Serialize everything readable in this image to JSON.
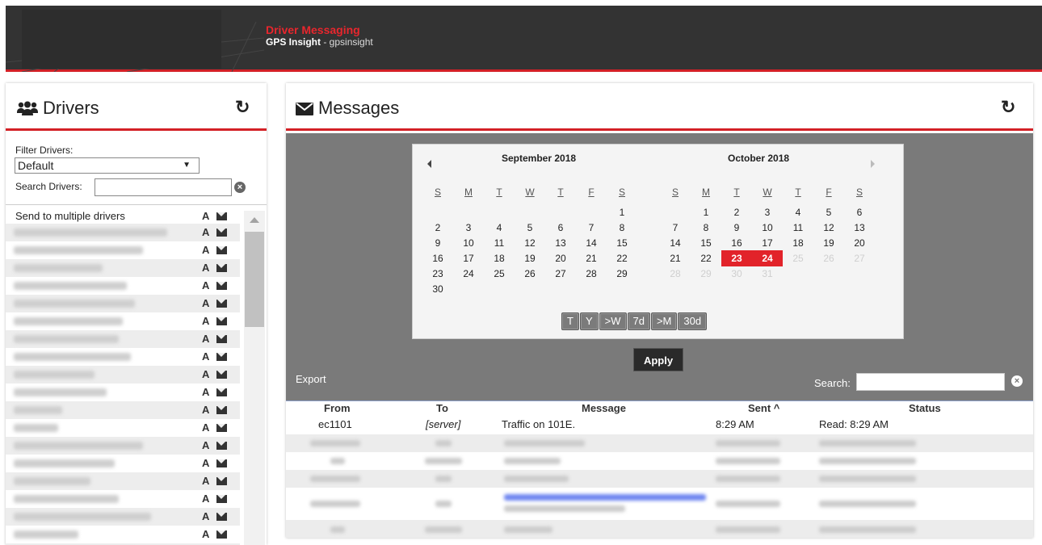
{
  "header": {
    "title": "Driver Messaging",
    "org": "GPS Insight",
    "account": " - gpsinsight"
  },
  "drivers": {
    "title": "Drivers",
    "filter_label": "Filter Drivers:",
    "filter_value": "Default",
    "search_label": "Search Drivers:",
    "multi_label": "Send to multiple drivers",
    "rows": 19
  },
  "messages": {
    "title": "Messages",
    "calendar": {
      "left_month": "September 2018",
      "right_month": "October 2018",
      "weekdays": [
        "S",
        "M",
        "T",
        "W",
        "T",
        "F",
        "S"
      ],
      "selected_days": [
        "23",
        "24"
      ]
    },
    "quick_ranges": [
      "T",
      "Y",
      ">W",
      "7d",
      ">M",
      "30d"
    ],
    "apply_label": "Apply",
    "export_label": "Export",
    "search_label": "Search:",
    "columns": {
      "from": "From",
      "to": "To",
      "message": "Message",
      "sent": "Sent ^",
      "status": "Status"
    },
    "first_row": {
      "from": "ec1101",
      "to": "[server]",
      "message": "Traffic on 101E.",
      "sent": "8:29 AM",
      "status": "Read: 8:29 AM"
    }
  },
  "colors": {
    "accent": "#d32026",
    "header_bg": "#333333",
    "calendar_panel_bg": "#7a7a7a"
  },
  "icons": {
    "drivers": "users-icon",
    "messages": "envelope-icon",
    "refresh": "refresh-icon",
    "clear": "clear-search-icon"
  }
}
